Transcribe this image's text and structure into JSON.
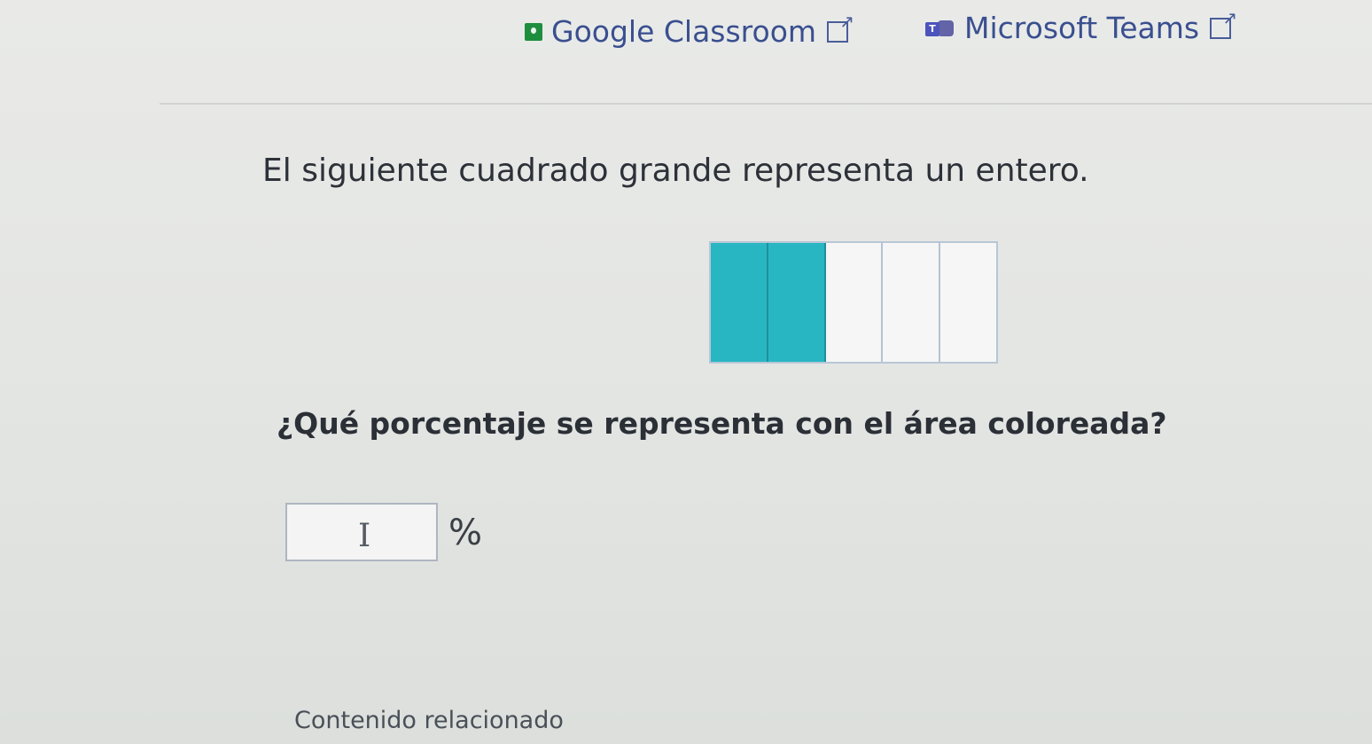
{
  "share": {
    "classroom": {
      "label": "Google Classroom",
      "icon": "google-classroom-icon",
      "color": "#1e8e3e"
    },
    "teams": {
      "label": "Microsoft Teams",
      "icon": "microsoft-teams-icon",
      "color": "#4b53bc"
    }
  },
  "exercise": {
    "prompt": "El siguiente cuadrado grande representa un entero.",
    "figure": {
      "parts": 5,
      "shaded_parts": 2,
      "shade_color": "#29b6c3"
    },
    "question": "¿Qué porcentaje se representa con el área coloreada?",
    "answer": {
      "value": "",
      "placeholder": ""
    },
    "unit": "%"
  },
  "related": {
    "label": "Contenido relacionado"
  }
}
